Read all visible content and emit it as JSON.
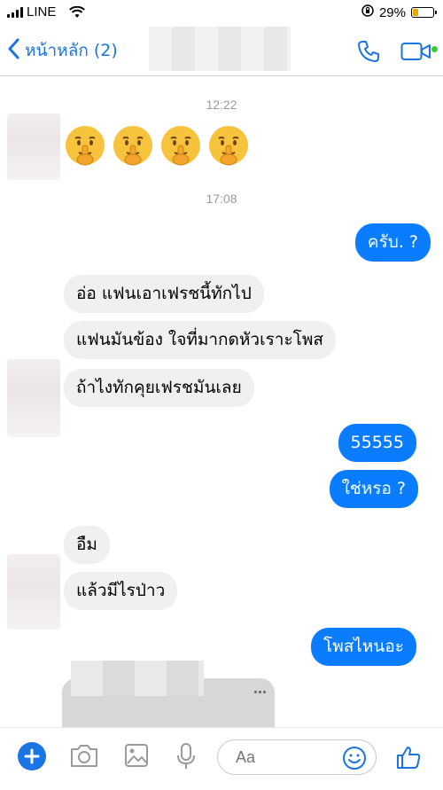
{
  "status_bar": {
    "carrier": "LINE",
    "battery": "29%",
    "battery_level": 0.29
  },
  "nav": {
    "back_label": "หน้าหลัก (2)",
    "accent": "#1b74e4"
  },
  "messages": {
    "time1": "12:22",
    "time2": "17:08",
    "emoji_name": "shushing-face-emoji",
    "out1": "ครับ. ?",
    "in1": "อ่อ แฟนเอาเฟรชนี้ทักไป",
    "in2": "แฟนมันข้อง ใจที่มากดหัวเราะโพส",
    "in3": "ถ้าไงทักคุยเฟรชมันเลย",
    "out2": "55555",
    "out3": "ใช่หรอ ?",
    "in4": "อืม",
    "in5": "แล้วมีไรป่าว",
    "out4": "โพสไหนอะ",
    "outgoing_color": "#0a7cff",
    "incoming_color": "#f0f0f0"
  },
  "composer": {
    "placeholder": "Aa"
  }
}
